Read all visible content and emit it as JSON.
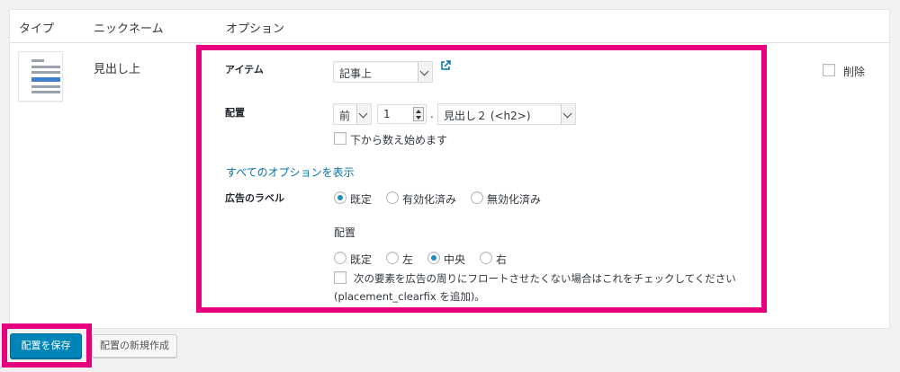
{
  "table": {
    "headers": {
      "type": "タイプ",
      "nickname": "ニックネーム",
      "options": "オプション"
    },
    "row": {
      "nickname": "見出し上",
      "item": {
        "label": "アイテム",
        "value": "記事上"
      },
      "placement": {
        "label": "配置",
        "position": "前",
        "index": "1",
        "separator": ".",
        "tag": "見出し２ (<h2>)",
        "count_from_bottom": "下から数え始めます"
      },
      "show_all_options": "すべてのオプションを表示",
      "ad_label": {
        "label": "広告のラベル",
        "options": [
          "既定",
          "有効化済み",
          "無効化済み"
        ],
        "selected": "既定"
      },
      "alignment": {
        "label": "配置",
        "options": [
          "既定",
          "左",
          "中央",
          "右"
        ],
        "selected": "中央",
        "clearfix_text": "次の要素を広告の周りにフロートさせたくない場合はこれをチェックしてください",
        "clearfix_note": "(placement_clearfix を追加)。"
      },
      "delete_label": "削除"
    }
  },
  "buttons": {
    "save": "配置を保存",
    "new": "配置の新規作成"
  },
  "colors": {
    "accent": "#e6007e",
    "primary": "#0085ba",
    "link": "#0073aa"
  }
}
